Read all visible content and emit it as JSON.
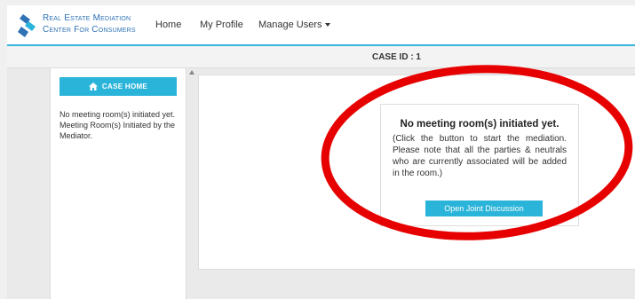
{
  "brand": {
    "line1": "Real Estate Mediation",
    "line2": "Center For Consumers"
  },
  "nav": {
    "home": "Home",
    "profile": "My Profile",
    "manage_users": "Manage Users"
  },
  "case_bar": {
    "label": "CASE ID : 1"
  },
  "sidebar": {
    "case_home_label": "CASE HOME",
    "line1": "No meeting room(s) initiated yet.",
    "line2": "Meeting Room(s) Initiated by the Mediator."
  },
  "notice": {
    "title": "No meeting room(s) initiated yet.",
    "body": "(Click the button to start the mediation. Please note that all the parties & neutrals who are currently associated will be added in the room.)",
    "button": "Open Joint Discussion"
  },
  "colors": {
    "accent": "#2bb4d9",
    "brand": "#2f73b6",
    "annotation": "#e60000"
  }
}
